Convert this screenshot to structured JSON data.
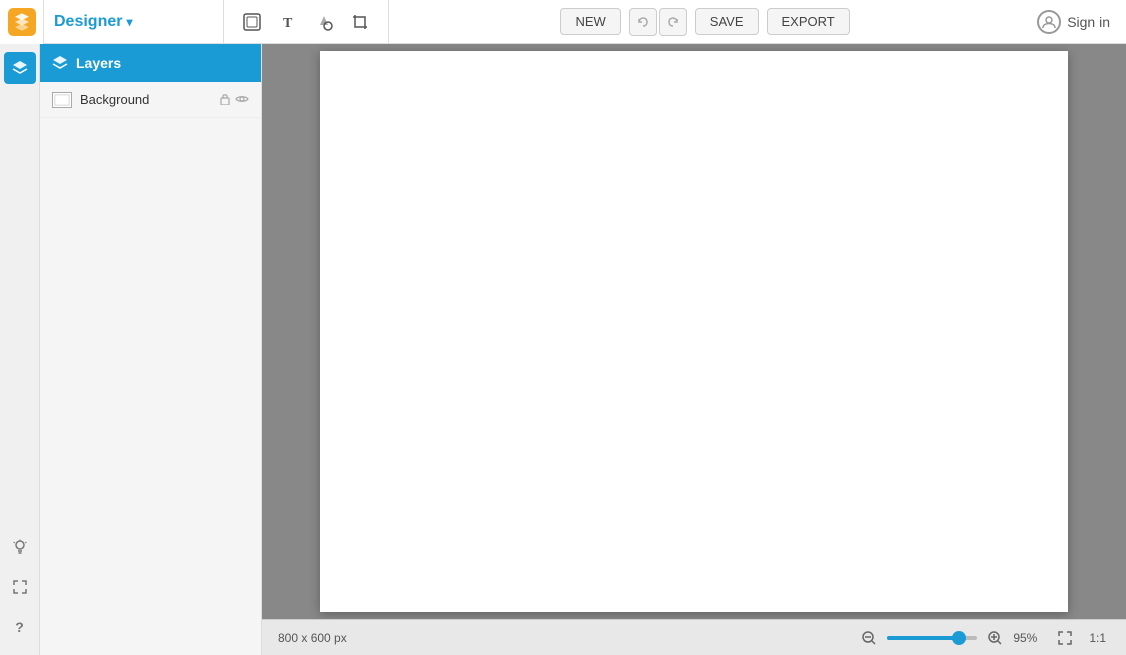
{
  "app": {
    "title": "Designer",
    "title_chevron": "▾"
  },
  "toolbar": {
    "tools": [
      {
        "name": "select-tool",
        "icon": "⊞",
        "label": "Select"
      },
      {
        "name": "text-tool",
        "icon": "T",
        "label": "Text"
      },
      {
        "name": "heart-tool",
        "icon": "♥",
        "label": "Shapes"
      },
      {
        "name": "crop-tool",
        "icon": "⊡",
        "label": "Crop"
      }
    ],
    "new_label": "NEW",
    "save_label": "SAVE",
    "export_label": "EXPORT",
    "signin_label": "Sign in"
  },
  "layers": {
    "panel_title": "Layers",
    "items": [
      {
        "name": "Background",
        "has_lock": true,
        "has_eye": true
      }
    ]
  },
  "canvas": {
    "size_label": "800 x 600 px",
    "zoom_percent": "95%",
    "ratio_label": "1:1"
  },
  "sidebar_bottom": [
    {
      "name": "lightbulb-icon",
      "icon": "💡"
    },
    {
      "name": "expand-icon",
      "icon": "⤢"
    },
    {
      "name": "help-icon",
      "icon": "?"
    }
  ]
}
